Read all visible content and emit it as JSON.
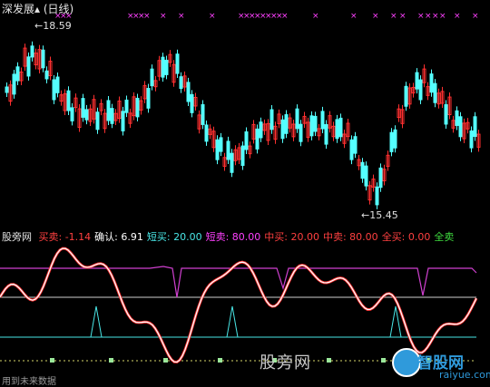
{
  "window": {
    "stock_name": "深发展",
    "title_suffix": "(日线)"
  },
  "candle_chart": {
    "type": "candlestick",
    "high_label": "18.59",
    "low_label": "15.45",
    "arrow_high": "←",
    "arrow_low": "←",
    "up_color": "#ff3030",
    "down_color": "#54ffff",
    "marker_color": "#ff40ff",
    "markers_text": "×××  ×  ××  ×"
  },
  "indicator": {
    "name": "股旁网",
    "items": [
      {
        "label": "买卖:",
        "value": "-1.14",
        "color": "#ff4040"
      },
      {
        "label": "确认:",
        "value": "6.91",
        "color": "#ffffff"
      },
      {
        "label": "短买:",
        "value": "20.00",
        "color": "#49e6e6"
      },
      {
        "label": "短卖:",
        "value": "80.00",
        "color": "#ff40ff"
      },
      {
        "label": "中买:",
        "value": "20.00",
        "color": "#ff4040"
      },
      {
        "label": "中卖:",
        "value": "80.00",
        "color": "#ff4040"
      },
      {
        "label": "全买:",
        "value": "0.00",
        "color": "#ff4040"
      },
      {
        "label": "全卖",
        "value": "",
        "color": "#3fdc3f"
      }
    ]
  },
  "watermarks": {
    "left_text": "股旁网",
    "right_text": "智股网",
    "right_url": "raiyue.com"
  },
  "footer_text": "用到未来数据"
}
